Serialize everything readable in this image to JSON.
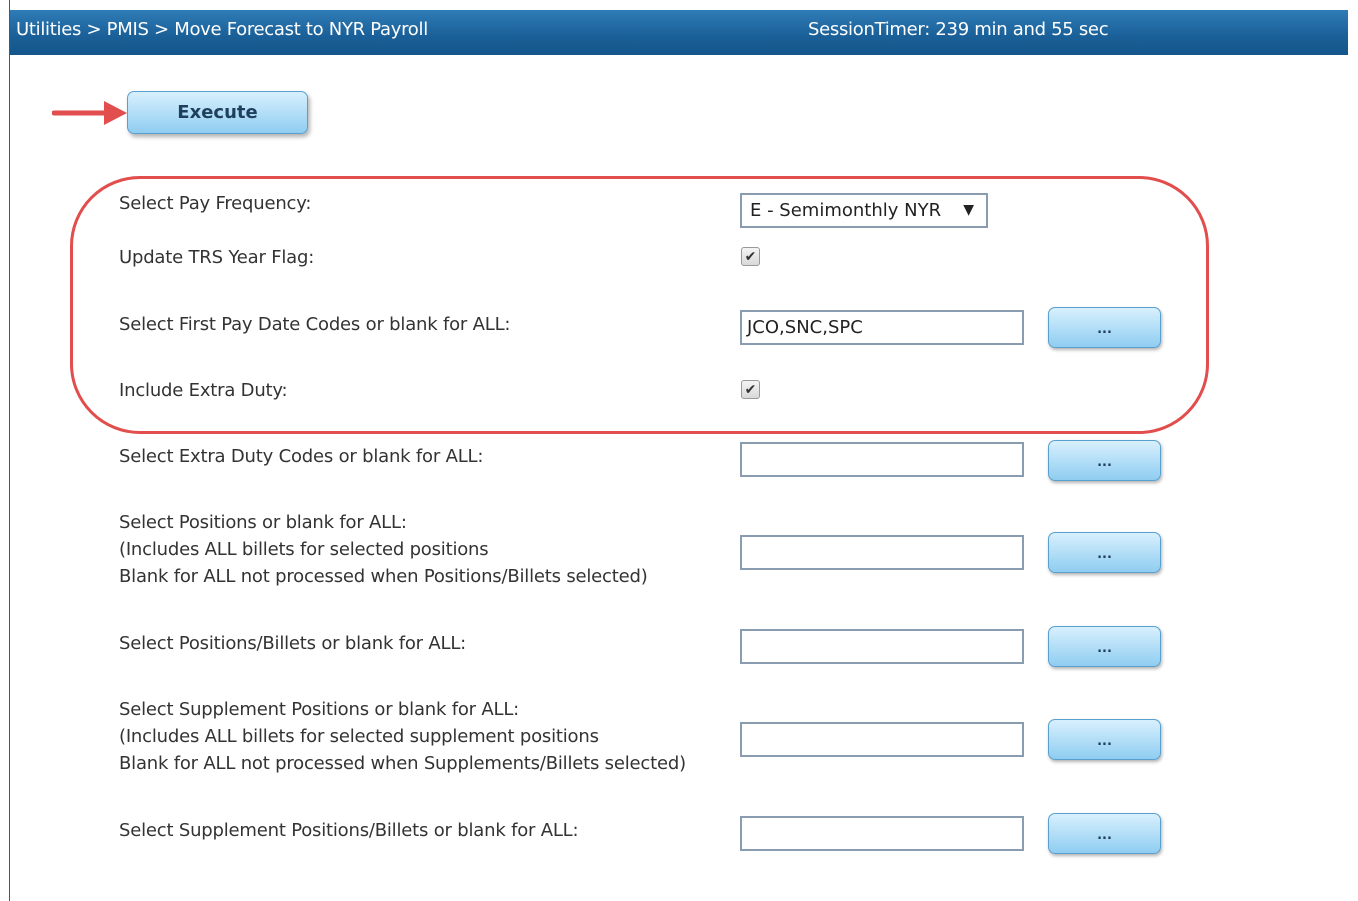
{
  "header": {
    "breadcrumb": "Utilities > PMIS > Move Forecast to NYR Payroll",
    "session_timer": "SessionTimer: 239 min and 55 sec"
  },
  "toolbar": {
    "execute_label": "Execute"
  },
  "form": {
    "pay_frequency": {
      "label": "Select Pay Frequency:",
      "value": "E - Semimonthly NYR",
      "caret": "▼"
    },
    "update_trs": {
      "label": "Update TRS Year Flag:",
      "checked": true,
      "mark": "✔"
    },
    "first_pay_date_codes": {
      "label": "Select First Pay Date Codes or blank for ALL:",
      "value": "JCO,SNC,SPC",
      "button": "..."
    },
    "include_extra_duty": {
      "label": "Include Extra Duty:",
      "checked": true,
      "mark": "✔"
    },
    "extra_duty_codes": {
      "label": "Select Extra Duty Codes or blank for ALL:",
      "value": "",
      "button": "..."
    },
    "positions": {
      "label_lines": [
        "Select Positions or blank for ALL:",
        "(Includes ALL billets for selected positions",
        "Blank for ALL not processed when Positions/Billets selected)"
      ],
      "value": "",
      "button": "..."
    },
    "positions_billets": {
      "label": "Select Positions/Billets or blank for ALL:",
      "value": "",
      "button": "..."
    },
    "supplement_positions": {
      "label_lines": [
        "Select Supplement Positions or blank for ALL:",
        "(Includes ALL billets for selected supplement positions",
        "Blank for ALL not processed when Supplements/Billets selected)"
      ],
      "value": "",
      "button": "..."
    },
    "supplement_billets": {
      "label": "Select Supplement Positions/Billets or blank for ALL:",
      "value": "",
      "button": "..."
    }
  },
  "colors": {
    "titlebar": "#1a5f97",
    "button": "#8fcdf1",
    "highlight": "#e24d4d",
    "arrow": "#e24d4d"
  }
}
